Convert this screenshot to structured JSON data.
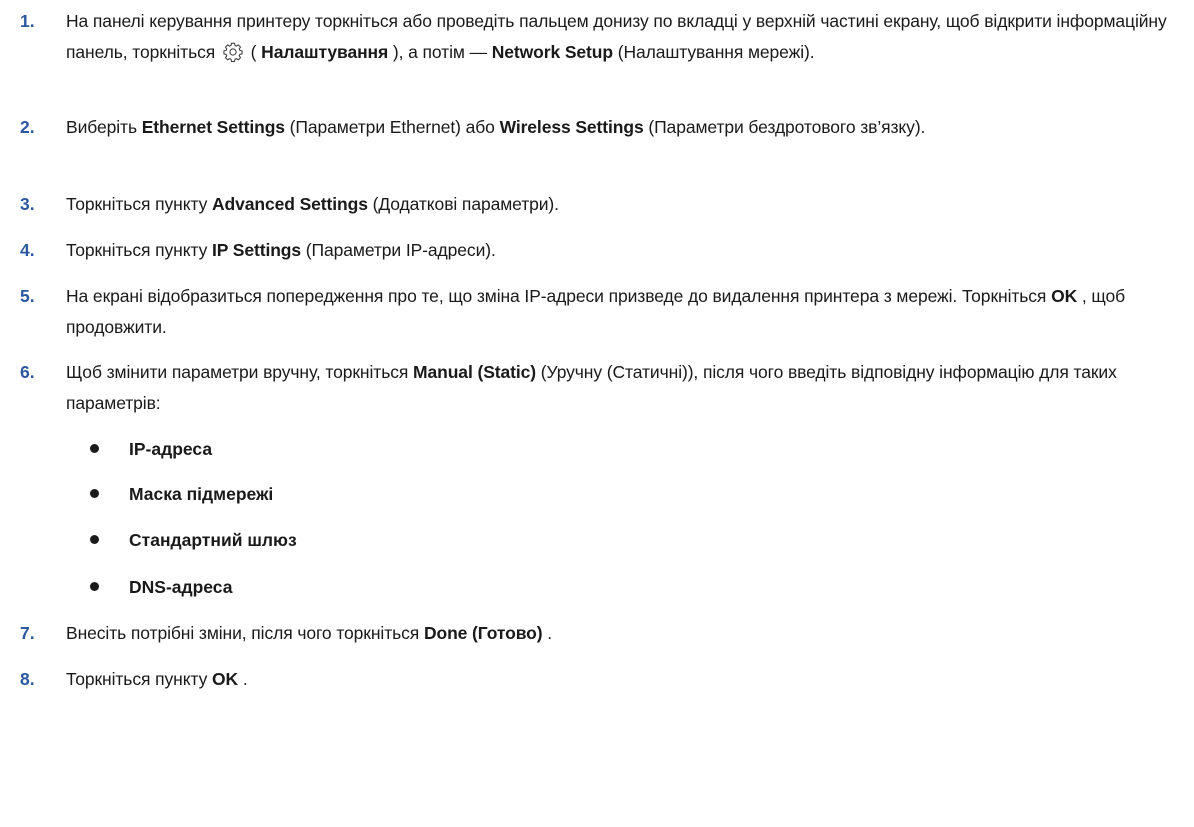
{
  "steps": [
    {
      "num": "1.",
      "parts": [
        {
          "t": "На панелі керування принтеру торкніться або проведіть пальцем донизу по вкладці у верхній частині екрану, щоб відкрити інформаційну панель, торкніться "
        },
        {
          "icon": "gear-icon"
        },
        {
          "t": " ( "
        },
        {
          "b": "Налаштування"
        },
        {
          "t": " ), а потім — "
        },
        {
          "b": "Network Setup"
        },
        {
          "t": " (Налаштування мережі)."
        }
      ]
    },
    {
      "num": "2.",
      "parts": [
        {
          "t": "Виберіть "
        },
        {
          "b": "Ethernet Settings"
        },
        {
          "t": " (Параметри Ethernet) або "
        },
        {
          "b": "Wireless Settings"
        },
        {
          "t": " (Параметри бездротового зв’язку)."
        }
      ]
    },
    {
      "num": "3.",
      "parts": [
        {
          "t": "Торкніться пункту "
        },
        {
          "b": "Advanced Settings"
        },
        {
          "t": " (Додаткові параметри)."
        }
      ]
    },
    {
      "num": "4.",
      "parts": [
        {
          "t": "Торкніться пункту "
        },
        {
          "b": "IP Settings"
        },
        {
          "t": " (Параметри IP-адреси)."
        }
      ]
    },
    {
      "num": "5.",
      "parts": [
        {
          "t": "На екрані відобразиться попередження про те, що зміна IP-адреси призведе до видалення принтера з мережі. Торкніться "
        },
        {
          "b": "OK"
        },
        {
          "t": " , щоб продовжити."
        }
      ]
    },
    {
      "num": "6.",
      "parts": [
        {
          "t": "Щоб змінити параметри вручну, торкніться "
        },
        {
          "b": "Manual (Static)"
        },
        {
          "t": " (Уручну (Статичні)), після чого введіть відповідну інформацію для таких параметрів:"
        }
      ]
    },
    {
      "num": "7.",
      "parts": [
        {
          "t": "Внесіть потрібні зміни, після чого торкніться "
        },
        {
          "b": "Done (Готово)"
        },
        {
          "t": " ."
        }
      ]
    },
    {
      "num": "8.",
      "parts": [
        {
          "t": "Торкніться пункту "
        },
        {
          "b": "OK"
        },
        {
          "t": " ."
        }
      ]
    }
  ],
  "bullets": [
    "IP-адреса",
    "Маска підмережі",
    "Стандартний шлюз",
    "DNS-адреса"
  ]
}
